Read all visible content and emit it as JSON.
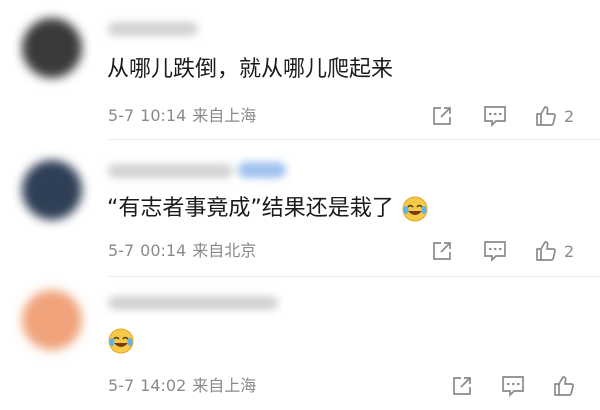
{
  "comments": [
    {
      "avatar_color": "#3a3a3a",
      "text": "从哪儿跌倒，就从哪儿爬起来",
      "date": "5-7",
      "time": "10:14",
      "location": "来自上海",
      "likes": "2",
      "icons": [
        "share-icon",
        "comment-icon",
        "thumbs-up-icon"
      ]
    },
    {
      "avatar_color": "#2f3f56",
      "text": "“有志者事竟成”结果还是栽了",
      "emoji": "laugh-cry-emoji",
      "date": "5-7",
      "time": "00:14",
      "location": "来自北京",
      "likes": "2",
      "icons": [
        "share-icon",
        "comment-icon",
        "thumbs-up-icon"
      ]
    },
    {
      "avatar_color": "#f0a37a",
      "emoji": "laugh-cry-emoji",
      "date": "5-7",
      "time": "14:02",
      "location": "来自上海",
      "icons": [
        "share-icon",
        "comment-icon",
        "thumbs-up-icon"
      ]
    }
  ],
  "colors": {
    "text": "#1b1b1b",
    "meta": "#8a8a8a",
    "divider": "#ececec"
  }
}
